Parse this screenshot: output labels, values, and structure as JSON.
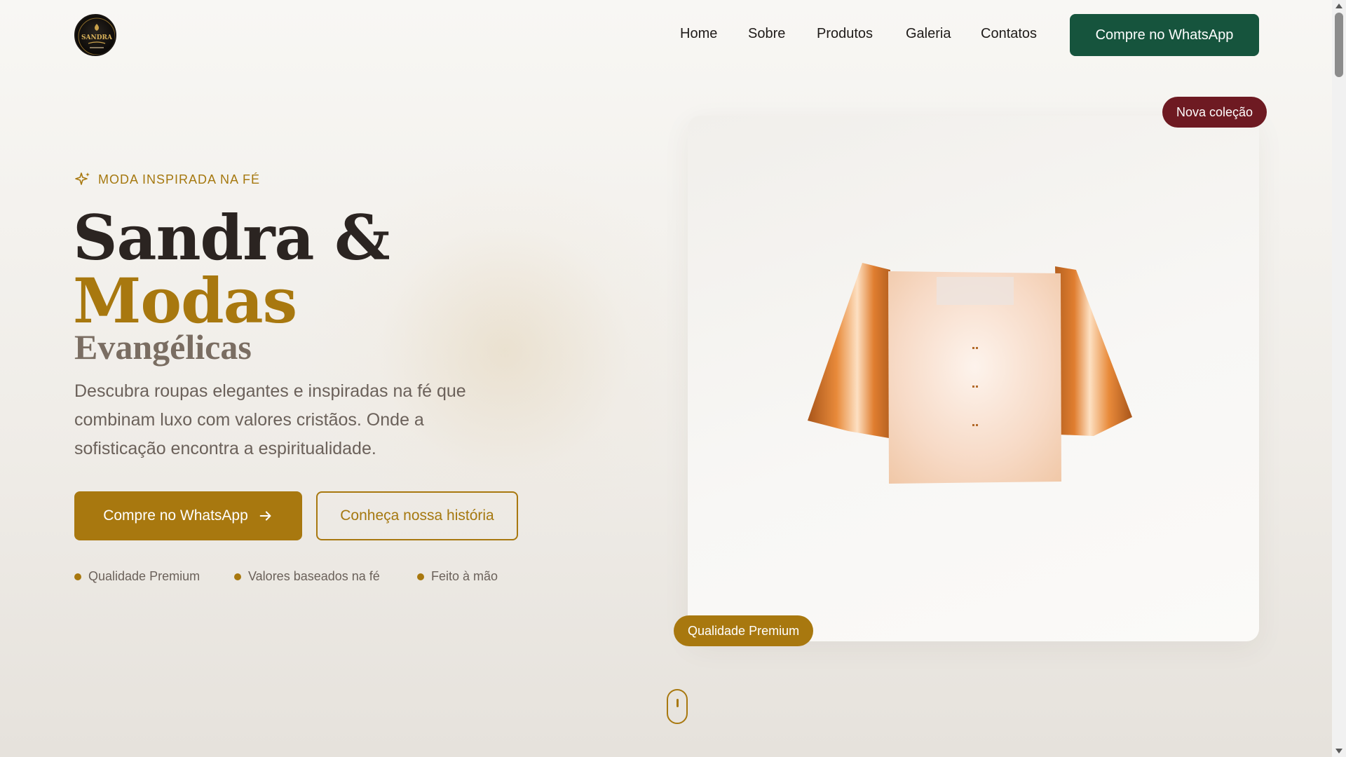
{
  "brand": {
    "logo_alt": "Sandra & Modas logo",
    "logo_text": "SANDRA"
  },
  "nav": {
    "items": [
      {
        "label": "Home"
      },
      {
        "label": "Sobre"
      },
      {
        "label": "Produtos"
      },
      {
        "label": "Galeria"
      },
      {
        "label": "Contatos"
      }
    ],
    "cta_label": "Compre no WhatsApp"
  },
  "hero": {
    "eyebrow_icon": "sparkle-icon",
    "eyebrow": "MODA INSPIRADA NA FÉ",
    "title_line1": "Sandra &",
    "title_line2": "Modas",
    "title_line3": "Evangélicas",
    "description": "Descubra roupas elegantes e inspiradas na fé que combinam luxo com valores cristãos. Onde a sofisticação encontra a espiritualidade.",
    "primary_button": "Compre no WhatsApp",
    "primary_button_icon": "arrow-right-icon",
    "secondary_button": "Conheça nossa história",
    "features": [
      {
        "label": "Qualidade Premium"
      },
      {
        "label": "Valores baseados na fé"
      },
      {
        "label": "Feito à mão"
      }
    ]
  },
  "showcase": {
    "badge_new": "Nova coleção",
    "badge_quality": "Qualidade Premium",
    "product_icon": "blouse-illustration"
  },
  "colors": {
    "gold": "#a8780f",
    "dark_green": "#16543d",
    "burgundy": "#6e1a22",
    "text_dark": "#2b2421",
    "text_muted": "#6b615a"
  }
}
